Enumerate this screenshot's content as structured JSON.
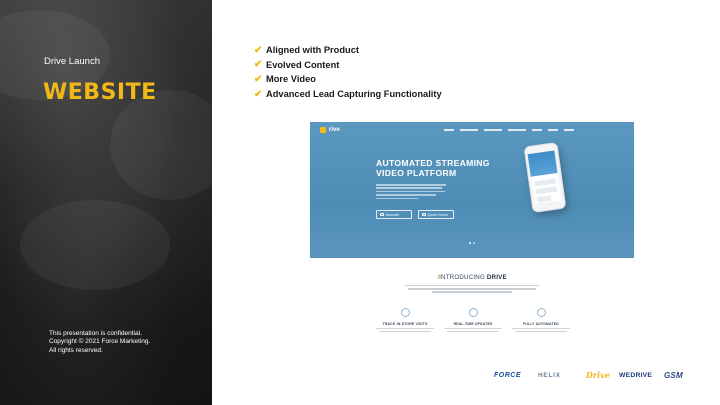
{
  "left_panel": {
    "kicker": "Drive Launch",
    "title": "WEBSITE",
    "confidential": "This presentation is confidential.",
    "copyright": "Copyright © 2021 Force Marketing.",
    "rights": "All rights reserved."
  },
  "bullets": [
    "Aligned with Product",
    "Evolved Content",
    "More Video",
    "Advanced Lead Capturing Functionality"
  ],
  "website": {
    "logo_word": "rive",
    "headline_line1": "AUTOMATED STREAMING",
    "headline_line2": "VIDEO PLATFORM",
    "button_1": "Discover",
    "button_2": "Quote Demo",
    "intro_prefix": "INTRODUCING",
    "intro_brand": "DRIVE",
    "features": [
      "TRACK IN-STORE VISITS",
      "REAL-TIME UPDATES",
      "FULLY AUTOMATED"
    ]
  },
  "brands": [
    "FORCE",
    "HELIX",
    "Drive",
    "WEDRIVE",
    "GSM"
  ],
  "colors": {
    "accent": "#f2b817",
    "panel_dark": "#1e1e1e",
    "site_blue": "#5590b9"
  }
}
